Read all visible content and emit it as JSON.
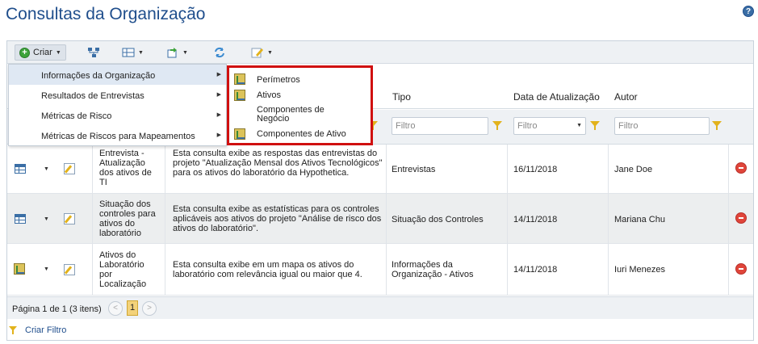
{
  "page": {
    "title": "Consultas da Organização"
  },
  "toolbar": {
    "create_label": "Criar"
  },
  "columns": [
    "Tipo",
    "Data de Atualização",
    "Autor"
  ],
  "filters": {
    "tipo_placeholder": "Filtro",
    "data_placeholder": "Filtro",
    "autor_placeholder": "Filtro"
  },
  "rows": [
    {
      "name": "Entrevista - Atualização dos ativos de TI",
      "description": "Esta consulta exibe as respostas das entrevistas do projeto \"Atualização Mensal dos Ativos Tecnológicos\" para os ativos do laboratório da Hypothetica.",
      "type": "Entrevistas",
      "date": "16/11/2018",
      "author": "Jane Doe"
    },
    {
      "name": "Situação dos controles para ativos do laboratório",
      "description": "Esta consulta exibe as estatísticas para os controles aplicáveis aos ativos do projeto \"Análise de risco dos ativos do laboratório\".",
      "type": "Situação dos Controles",
      "date": "14/11/2018",
      "author": "Mariana Chu"
    },
    {
      "name": "Ativos do Laboratório por Localização",
      "description": "Esta consulta exibe em um mapa os ativos do laboratório com relevância igual ou maior que 4.",
      "type": "Informações da Organização - Ativos",
      "date": "14/11/2018",
      "author": "Iuri Menezes"
    }
  ],
  "pager": {
    "text": "Página 1 de 1 (3 itens)",
    "current": "1"
  },
  "footer": {
    "create_filter": "Criar Filtro"
  },
  "create_menu": {
    "items": [
      "Informações da Organização",
      "Resultados de Entrevistas",
      "Métricas de Risco",
      "Métricas de Riscos para Mapeamentos"
    ]
  },
  "submenu": {
    "items": [
      "Perímetros",
      "Ativos",
      "Componentes de Negócio",
      "Componentes de Ativo"
    ]
  }
}
